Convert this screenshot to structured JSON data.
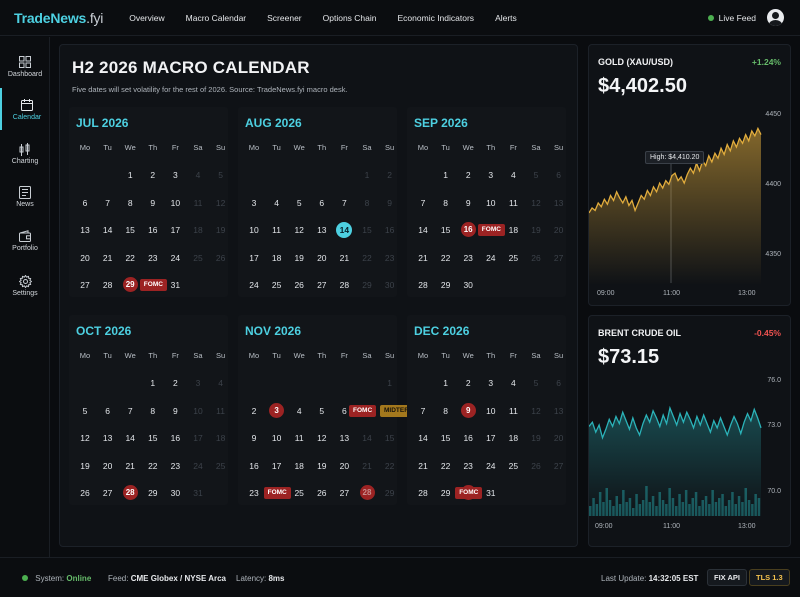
{
  "app": {
    "logo_main": "TradeNews",
    "logo_suffix": ".fyi"
  },
  "nav": [
    "Overview",
    "Macro Calendar",
    "Screener",
    "Options Chain",
    "Economic Indicators",
    "Alerts"
  ],
  "header": {
    "live_feed": "Live Feed"
  },
  "sidebar": [
    {
      "label": "Dashboard",
      "icon": "grid-icon"
    },
    {
      "label": "Calendar",
      "icon": "calendar-icon",
      "active": true
    },
    {
      "label": "Charting",
      "icon": "candlestick-icon"
    },
    {
      "label": "News",
      "icon": "newspaper-icon"
    },
    {
      "label": "Portfolio",
      "icon": "wallet-icon"
    },
    {
      "label": "Settings",
      "icon": "gear-icon"
    }
  ],
  "calendar": {
    "title": "H2 2026 MACRO CALENDAR",
    "subtitle": "Five dates will set volatility for the rest of 2026. Source: TradeNews.fyi macro desk.",
    "dow": [
      "Mo",
      "Tu",
      "We",
      "Th",
      "Fr",
      "Sa",
      "Su"
    ],
    "months": [
      {
        "name": "JUL 2026",
        "offset": 2,
        "days": 31,
        "events": [
          {
            "day": 29,
            "tag": "FOMC",
            "color": "red"
          }
        ],
        "circled": [
          29
        ]
      },
      {
        "name": "AUG 2026",
        "offset": 5,
        "days": 31,
        "today": 14,
        "events": [],
        "circled": []
      },
      {
        "name": "SEP 2026",
        "offset": 1,
        "days": 30,
        "events": [
          {
            "day": 16,
            "tag": "FOMC",
            "color": "red"
          }
        ],
        "circled": [
          16
        ]
      },
      {
        "name": "OCT 2026",
        "offset": 3,
        "days": 31,
        "events": [
          {
            "day": 28,
            "tag": "",
            "color": "red"
          }
        ],
        "circled": [
          28
        ]
      },
      {
        "name": "NOV 2026",
        "offset": 6,
        "days": 30,
        "events": [
          {
            "day": 3,
            "tag": "",
            "color": "red"
          },
          {
            "day": 4,
            "tag": "FOMC",
            "color": "red",
            "tagAt": 6
          },
          {
            "day": 4,
            "tag": "MIDTERMS",
            "color": "gold",
            "tagAt": 6,
            "second": true
          },
          {
            "day": 28,
            "tag": "FOMC",
            "color": "red",
            "at": 23
          }
        ],
        "circled": [
          3,
          28
        ]
      },
      {
        "name": "DEC 2026",
        "offset": 1,
        "days": 31,
        "events": [
          {
            "day": 9,
            "tag": "",
            "color": "red",
            "faint": true
          },
          {
            "day": 30,
            "tag": "FOMC",
            "color": "red",
            "at": 29
          }
        ],
        "circled": [
          9,
          30
        ]
      }
    ]
  },
  "markets": [
    {
      "name": "GOLD (XAU/USD)",
      "change": "+1.24%",
      "change_color": "#66bb6a",
      "price": "$4,402.50",
      "accent": "#e2ad3d",
      "chart_data": {
        "type": "area",
        "x_ticks": [
          "09:00",
          "11:00",
          "13:00"
        ],
        "y_ticks": [
          "4450",
          "4400",
          "4350"
        ],
        "ylim": [
          4320,
          4460
        ],
        "tooltip": "High: $4,410.20",
        "values": [
          4378,
          4382,
          4380,
          4386,
          4383,
          4389,
          4385,
          4392,
          4388,
          4395,
          4390,
          4386,
          4391,
          4384,
          4388,
          4380,
          4386,
          4392,
          4389,
          4396,
          4392,
          4399,
          4395,
          4402,
          4398,
          4404,
          4401,
          4408,
          4410,
          4404,
          4407,
          4402,
          4409,
          4414,
          4410,
          4418,
          4412,
          4420,
          4416,
          4424,
          4419,
          4426,
          4422,
          4430,
          4425,
          4433,
          4428,
          4436,
          4431,
          4438,
          4434,
          4441,
          4436,
          4444,
          4440,
          4446,
          4441
        ]
      }
    },
    {
      "name": "BRENT CRUDE OIL",
      "change": "-0.45%",
      "change_color": "#ef5350",
      "price": "$73.15",
      "accent": "#2bb3b9",
      "chart_data": {
        "type": "line",
        "x_ticks": [
          "09:00",
          "11:00",
          "13:00"
        ],
        "y_ticks": [
          "76.0",
          "73.0",
          "70.0"
        ],
        "ylim": [
          69.0,
          77.0
        ],
        "values": [
          73.6,
          73.9,
          73.2,
          73.7,
          72.8,
          73.4,
          74.1,
          73.6,
          74.3,
          73.8,
          74.6,
          74.0,
          73.4,
          74.2,
          73.5,
          73.0,
          73.8,
          74.4,
          73.9,
          74.7,
          74.2,
          73.6,
          74.4,
          73.8,
          74.9,
          74.3,
          73.7,
          74.5,
          73.9,
          74.6,
          74.1,
          73.5,
          74.3,
          73.7,
          74.4,
          73.8,
          73.2,
          74.0,
          73.5,
          74.2,
          73.6,
          73.0,
          73.7,
          74.3,
          73.8,
          73.1,
          73.9,
          74.5,
          74.0,
          74.8,
          74.2,
          73.5
        ],
        "volume": [
          5,
          9,
          6,
          12,
          7,
          14,
          8,
          5,
          10,
          6,
          13,
          7,
          9,
          4,
          11,
          6,
          8,
          15,
          7,
          10,
          5,
          12,
          8,
          6,
          14,
          9,
          5,
          11,
          7,
          13,
          6,
          9,
          12,
          5,
          8,
          10,
          6,
          13,
          7,
          9,
          11,
          5,
          8,
          12,
          6,
          10,
          7,
          14,
          8,
          6,
          11,
          9
        ]
      }
    }
  ],
  "status": {
    "system_label": "System:",
    "system_value": "Online",
    "feed_label": "Feed:",
    "feed_value": "CME Globex / NYSE Arca",
    "latency_label": "Latency:",
    "latency_value": "8ms",
    "update_label": "Last Update:",
    "update_value": "14:32:05 EST",
    "btn_fix": "FIX API",
    "btn_tls": "TLS 1.3"
  }
}
